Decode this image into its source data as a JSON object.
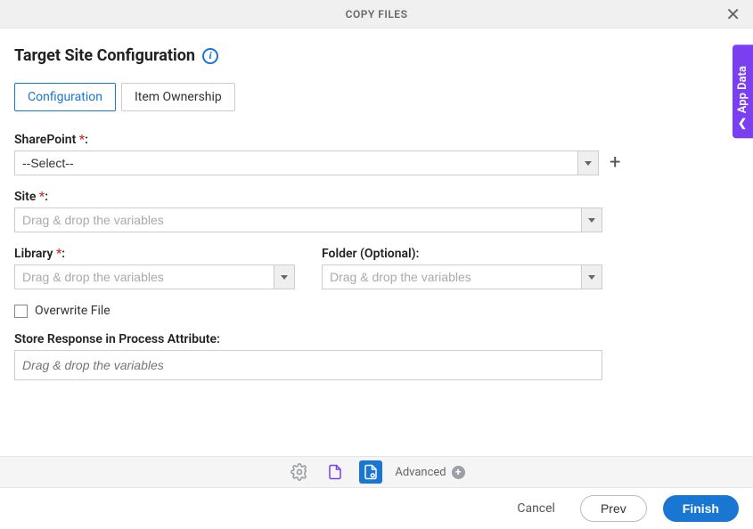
{
  "header": {
    "title": "COPY FILES"
  },
  "section": {
    "title": "Target Site Configuration"
  },
  "tabs": [
    {
      "label": "Configuration",
      "active": true
    },
    {
      "label": "Item Ownership",
      "active": false
    }
  ],
  "fields": {
    "sharepoint": {
      "label": "SharePoint ",
      "req": "*",
      "colon": ":",
      "value": "--Select--"
    },
    "site": {
      "label": "Site ",
      "req": "*",
      "colon": ":",
      "placeholder": "Drag & drop the variables"
    },
    "library": {
      "label": "Library ",
      "req": "*",
      "colon": ":",
      "placeholder": "Drag & drop the variables"
    },
    "folder": {
      "label": "Folder (Optional):",
      "placeholder": "Drag & drop the variables"
    },
    "overwrite": {
      "label": "Overwrite File"
    },
    "store": {
      "label": "Store Response in Process Attribute:",
      "placeholder": "Drag & drop the variables"
    }
  },
  "toolbar": {
    "advanced": "Advanced"
  },
  "side": {
    "label": "App Data"
  },
  "footer": {
    "cancel": "Cancel",
    "prev": "Prev",
    "finish": "Finish"
  }
}
